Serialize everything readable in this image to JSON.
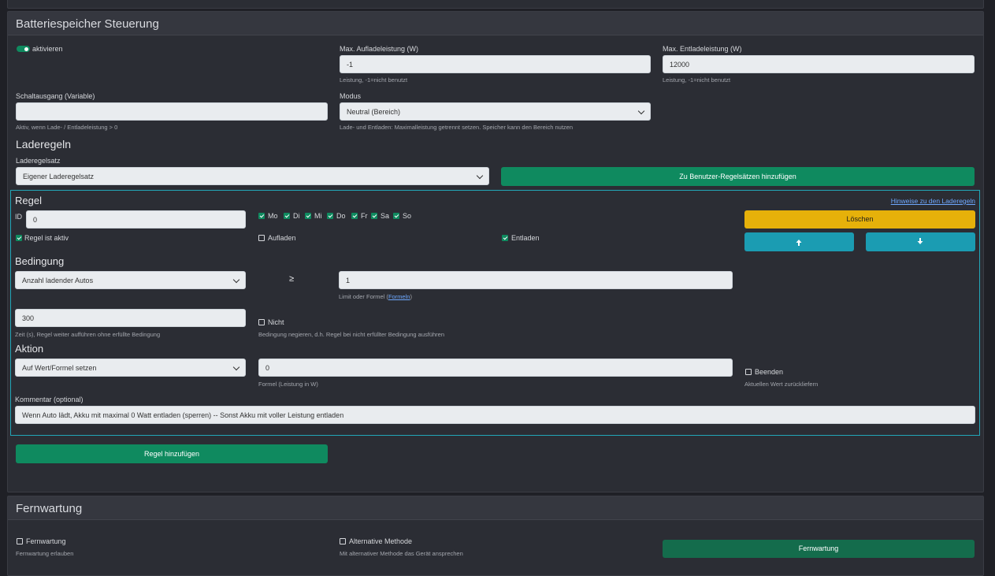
{
  "battery": {
    "title": "Batteriespeicher Steuerung",
    "activate_label": "aktivieren",
    "max_charge": {
      "label": "Max. Aufladeleistung (W)",
      "value": "-1",
      "help": "Leistung, -1=nicht benutzt"
    },
    "max_discharge": {
      "label": "Max. Entladeleistung (W)",
      "value": "12000",
      "help": "Leistung, -1=nicht benutzt"
    },
    "switch_output": {
      "label": "Schaltausgang (Variable)",
      "value": "",
      "help": "Aktiv, wenn Lade- / Entladeleistung > 0"
    },
    "mode": {
      "label": "Modus",
      "value": "Neutral (Bereich)",
      "help": "Lade- und Entladen: Maximalleistung getrennt setzen. Speicher kann den Bereich nutzen"
    }
  },
  "rules": {
    "heading": "Laderegeln",
    "ruleset_label": "Laderegelsatz",
    "ruleset_value": "Eigener Laderegelsatz",
    "add_to_user_button": "Zu Benutzer-Regelsätzen hinzufügen",
    "rule": {
      "heading": "Regel",
      "hints_link": "Hinweise zu den Laderegeln",
      "id_label": "ID",
      "id_value": "0",
      "days": [
        "Mo",
        "Di",
        "Mi",
        "Do",
        "Fr",
        "Sa",
        "So"
      ],
      "active_label": "Regel ist aktiv",
      "charge_label": "Aufladen",
      "discharge_label": "Entladen",
      "delete_button": "Löschen",
      "up_icon": "arrow-up-icon",
      "down_icon": "arrow-down-icon",
      "condition_heading": "Bedingung",
      "condition_value": "Anzahl ladender Autos",
      "operator": "≥",
      "limit_value": "1",
      "limit_help_prefix": "Limit oder Formel (",
      "limit_help_link": "Formeln",
      "limit_help_suffix": ")",
      "time_value": "300",
      "time_help": "Zeit (s), Regel weiter aufführen ohne erfüllte Bedingung",
      "not_label": "Nicht",
      "not_help": "Bedingung negieren, d.h. Regel bei nicht erfüllter Bedingung ausführen",
      "action_heading": "Aktion",
      "action_value": "Auf Wert/Formel setzen",
      "formula_value": "0",
      "formula_help": "Formel (Leistung in W)",
      "end_label": "Beenden",
      "end_help": "Aktuellen Wert zurückliefern",
      "comment_label": "Kommentar (optional)",
      "comment_value": "Wenn Auto lädt, Akku mit maximal 0 Watt entladen (sperren) -- Sonst Akku mit voller Leistung entladen"
    },
    "add_rule_button": "Regel hinzufügen"
  },
  "remote": {
    "title": "Fernwartung",
    "remote_label": "Fernwartung",
    "remote_help": "Fernwartung erlauben",
    "alt_label": "Alternative Methode",
    "alt_help": "Mit alternativer Methode das Gerät ansprechen",
    "button": "Fernwartung"
  },
  "colors": {
    "accent_green": "#0f8a5f",
    "warning_yellow": "#e6b10a",
    "info_teal": "#1b9cb2",
    "rule_border": "#22a6b8"
  }
}
